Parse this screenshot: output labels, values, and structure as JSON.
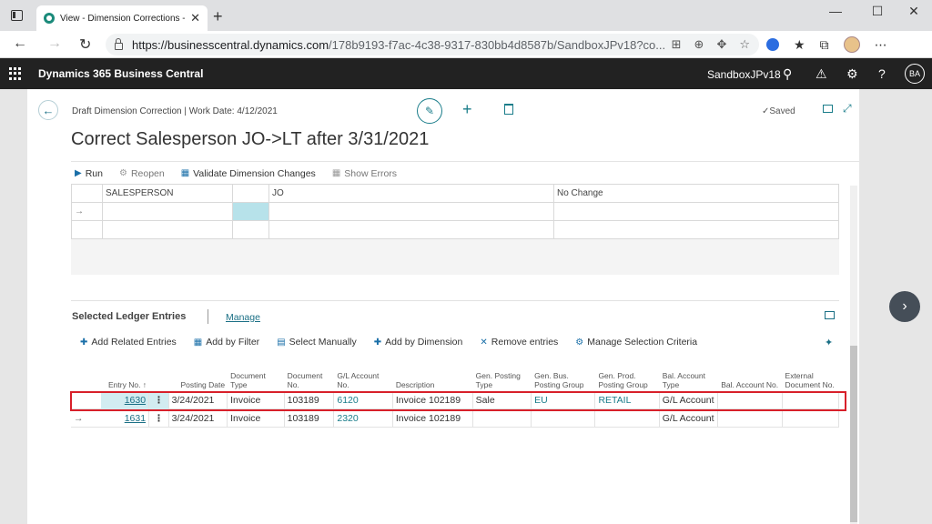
{
  "browser": {
    "tab_title": "View - Dimension Corrections - D",
    "tab_close": "✕",
    "new_tab": "+",
    "url_host": "https://businesscentral.dynamics.com",
    "url_path": "/178b9193-f7ac-4c38-9317-830bb4d8587b/SandboxJPv18?co...",
    "window_controls": [
      "—",
      "☐",
      "✕"
    ]
  },
  "app": {
    "name": "Dynamics 365 Business Central",
    "environment": "SandboxJPv18",
    "user_initials": "BA"
  },
  "page": {
    "breadcrumb": "Draft Dimension Correction | Work Date: 4/12/2021",
    "title": "Correct Salesperson JO->LT after 3/31/2021",
    "saved_label": "Saved",
    "actions": [
      {
        "label": "Run",
        "icon": "run-icon",
        "disabled": false
      },
      {
        "label": "Reopen",
        "icon": "reopen-icon",
        "disabled": true
      },
      {
        "label": "Validate Dimension Changes",
        "icon": "validate-icon",
        "disabled": false
      },
      {
        "label": "Show Errors",
        "icon": "show-errors-icon",
        "disabled": true
      }
    ]
  },
  "dimension_grid": {
    "rows": [
      {
        "arrow": "",
        "dimension": "SALESPERSON",
        "new_value": "",
        "value": "JO",
        "change": "No Change"
      },
      {
        "arrow": "→",
        "dimension": "",
        "new_value": "",
        "value": "",
        "change": ""
      },
      {
        "arrow": "",
        "dimension": "",
        "new_value": "",
        "value": "",
        "change": ""
      }
    ]
  },
  "ledger": {
    "title": "Selected Ledger Entries",
    "manage_label": "Manage",
    "actions": [
      {
        "label": "Add Related Entries",
        "icon": "add-related-icon"
      },
      {
        "label": "Add by Filter",
        "icon": "filter-icon"
      },
      {
        "label": "Select Manually",
        "icon": "select-manually-icon"
      },
      {
        "label": "Add by Dimension",
        "icon": "dimension-icon"
      },
      {
        "label": "Remove entries",
        "icon": "remove-icon"
      },
      {
        "label": "Manage Selection Criteria",
        "icon": "criteria-icon"
      }
    ],
    "columns": [
      {
        "label": "Entry No. ↑",
        "width": 54
      },
      {
        "label": "",
        "width": 22
      },
      {
        "label": "Posting Date",
        "width": 66
      },
      {
        "label": "Document Type",
        "width": 64
      },
      {
        "label": "Document No.",
        "width": 56
      },
      {
        "label": "G/L Account No.",
        "width": 66
      },
      {
        "label": "Description",
        "width": 90
      },
      {
        "label": "Gen. Posting Type",
        "width": 66
      },
      {
        "label": "Gen. Bus. Posting Group",
        "width": 72
      },
      {
        "label": "Gen. Prod. Posting Group",
        "width": 72
      },
      {
        "label": "Bal. Account Type",
        "width": 66
      },
      {
        "label": "Bal. Account No.",
        "width": 72
      },
      {
        "label": "External Document No.",
        "width": 64
      }
    ],
    "rows": [
      {
        "selected": true,
        "arrow": "",
        "entry_no": "1630",
        "posting_date": "3/24/2021",
        "doc_type": "Invoice",
        "doc_no": "103189",
        "gl_account": "6120",
        "description": "Invoice 102189",
        "gen_posting_type": "Sale",
        "gen_bus_group": "EU",
        "gen_prod_group": "RETAIL",
        "bal_account_type": "G/L Account",
        "bal_account_no": "",
        "ext_doc_no": ""
      },
      {
        "selected": false,
        "arrow": "→",
        "entry_no": "1631",
        "posting_date": "3/24/2021",
        "doc_type": "Invoice",
        "doc_no": "103189",
        "gl_account": "2320",
        "description": "Invoice 102189",
        "gen_posting_type": "",
        "gen_bus_group": "",
        "gen_prod_group": "",
        "bal_account_type": "G/L Account",
        "bal_account_no": "",
        "ext_doc_no": ""
      }
    ]
  }
}
